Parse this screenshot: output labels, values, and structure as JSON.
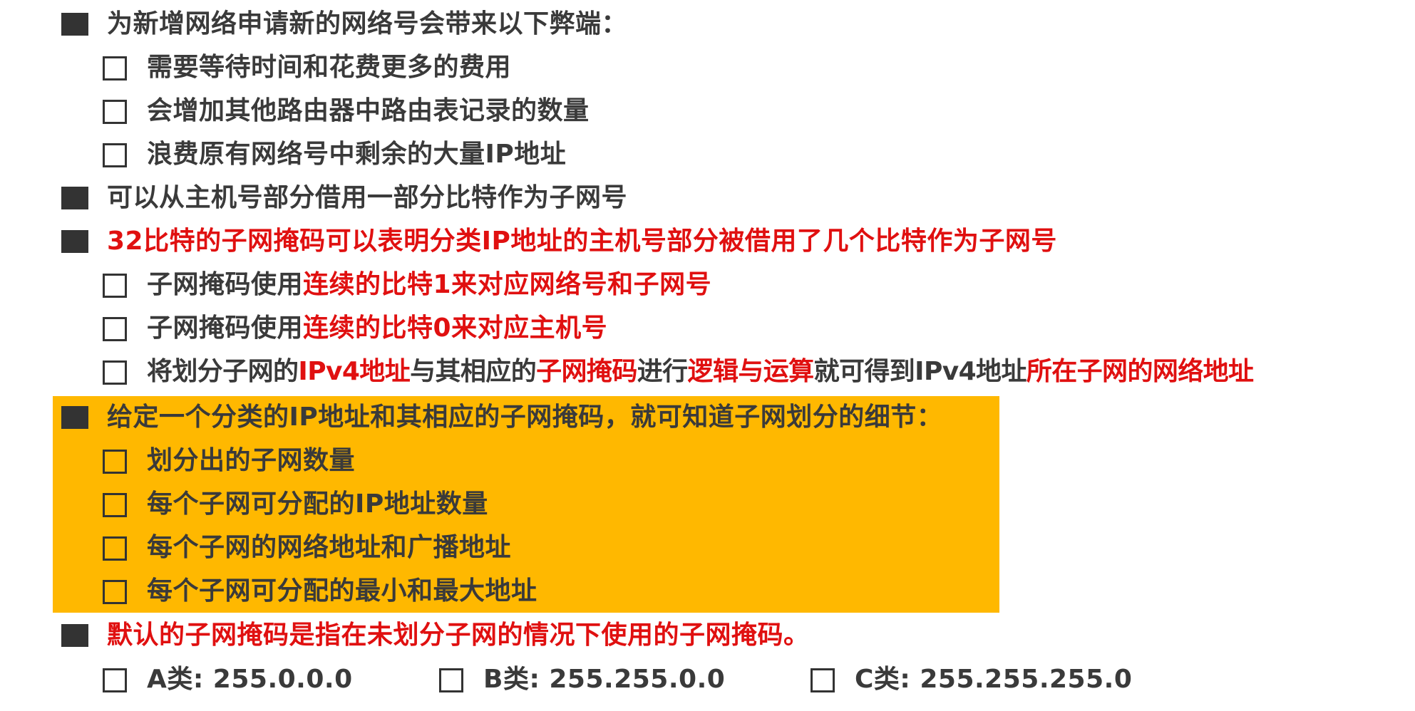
{
  "bullets": {
    "b1": "为新增网络申请新的网络号会带来以下弊端：",
    "b1_sub": [
      "需要等待时间和花费更多的费用",
      "会增加其他路由器中路由表记录的数量",
      "浪费原有网络号中剩余的大量IP地址"
    ],
    "b2": "可以从主机号部分借用一部分比特作为子网号",
    "b3": "32比特的子网掩码可以表明分类IP地址的主机号部分被借用了几个比特作为子网号",
    "b3_sub1": {
      "a": "子网掩码使用",
      "b": "连续的比特1来对应网络号和子网号"
    },
    "b3_sub2": {
      "a": "子网掩码使用",
      "b": "连续的比特0来对应主机号"
    },
    "b3_sub3": {
      "a": "将划分子网的",
      "b": "IPv4地址",
      "c": "与其相应的",
      "d": "子网掩码",
      "e": "进行",
      "f": "逻辑与运算",
      "g": "就可得到IPv4地址",
      "h": "所在子网的网络地址"
    },
    "b4": "给定一个分类的IP地址和其相应的子网掩码，就可知道子网划分的细节：",
    "b4_sub": [
      "划分出的子网数量",
      "每个子网可分配的IP地址数量",
      "每个子网的网络地址和广播地址",
      "每个子网可分配的最小和最大地址"
    ],
    "b5": "默认的子网掩码是指在未划分子网的情况下使用的子网掩码。",
    "b5_classes": [
      "A类: 255.0.0.0",
      "B类: 255.255.0.0",
      "C类: 255.255.255.0"
    ]
  },
  "colors": {
    "highlight": "#ffb800",
    "red": "#e01010",
    "text": "#3a3a3a"
  }
}
